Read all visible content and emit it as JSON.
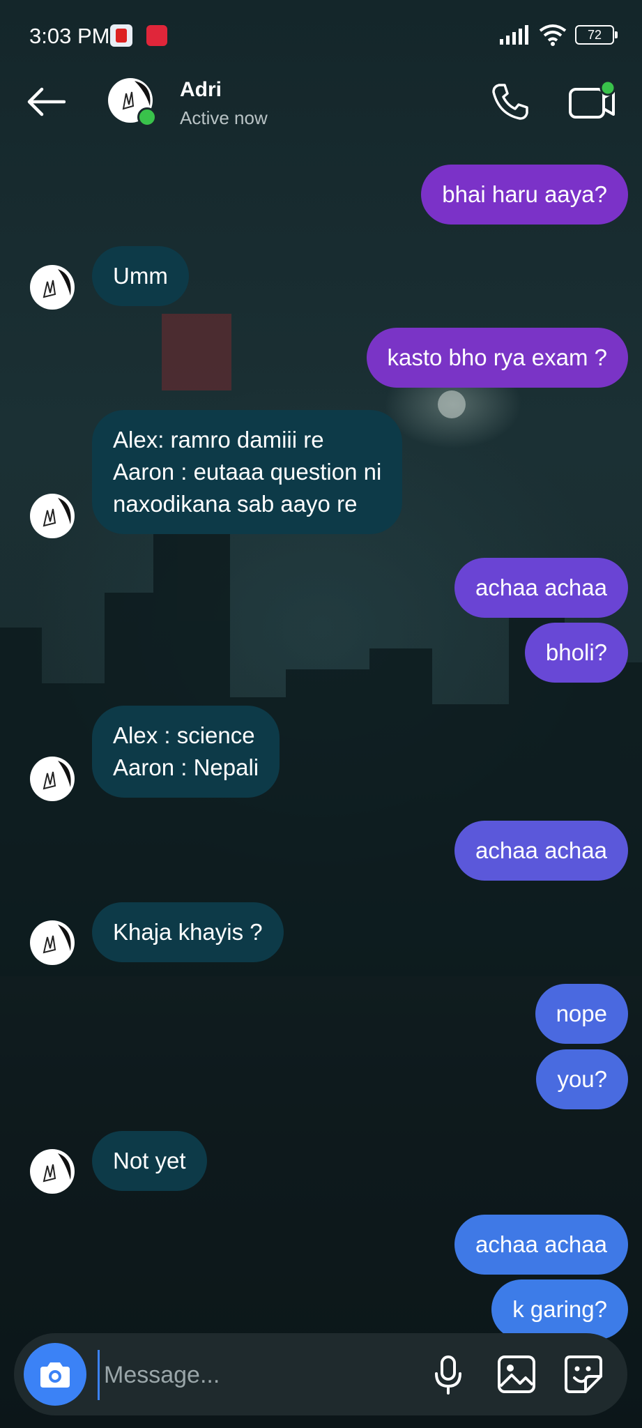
{
  "status_bar": {
    "time": "3:03 PM",
    "battery": "72"
  },
  "header": {
    "name": "Adri",
    "status": "Active now"
  },
  "messages": [
    {
      "text": "bhai haru aaya?",
      "side": "out",
      "color": "#7b32c8"
    },
    {
      "text": "Umm",
      "side": "in"
    },
    {
      "text": "kasto bho rya exam ?",
      "side": "out",
      "color": "#7a34c6"
    },
    {
      "lines": [
        "Alex: ramro damiii re",
        "Aaron : eutaaa question ni",
        "naxodikana sab aayo re"
      ],
      "side": "in"
    },
    {
      "text": "achaa achaa",
      "side": "out",
      "color": "#6a44d4"
    },
    {
      "text": "bholi?",
      "side": "out",
      "color": "#6848d6"
    },
    {
      "lines": [
        "Alex : science",
        "Aaron : Nepali"
      ],
      "side": "in"
    },
    {
      "text": "achaa achaa",
      "side": "out",
      "color": "#5b58da"
    },
    {
      "text": "Khaja khayis ?",
      "side": "in"
    },
    {
      "text": "nope",
      "side": "out",
      "color": "#4a69e0"
    },
    {
      "text": "you?",
      "side": "out",
      "color": "#496be0"
    },
    {
      "text": "Not yet",
      "side": "in"
    },
    {
      "text": "achaa achaa",
      "side": "out",
      "color": "#3f79e6"
    },
    {
      "text": "k garing?",
      "side": "out",
      "color": "#3d7ce8"
    }
  ],
  "composer": {
    "placeholder": "Message..."
  },
  "icons": {
    "back": "arrow-left-icon",
    "call": "phone-icon",
    "video": "video-camera-icon",
    "camera": "camera-icon",
    "mic": "microphone-icon",
    "gallery": "image-icon",
    "sticker": "sticker-icon"
  }
}
